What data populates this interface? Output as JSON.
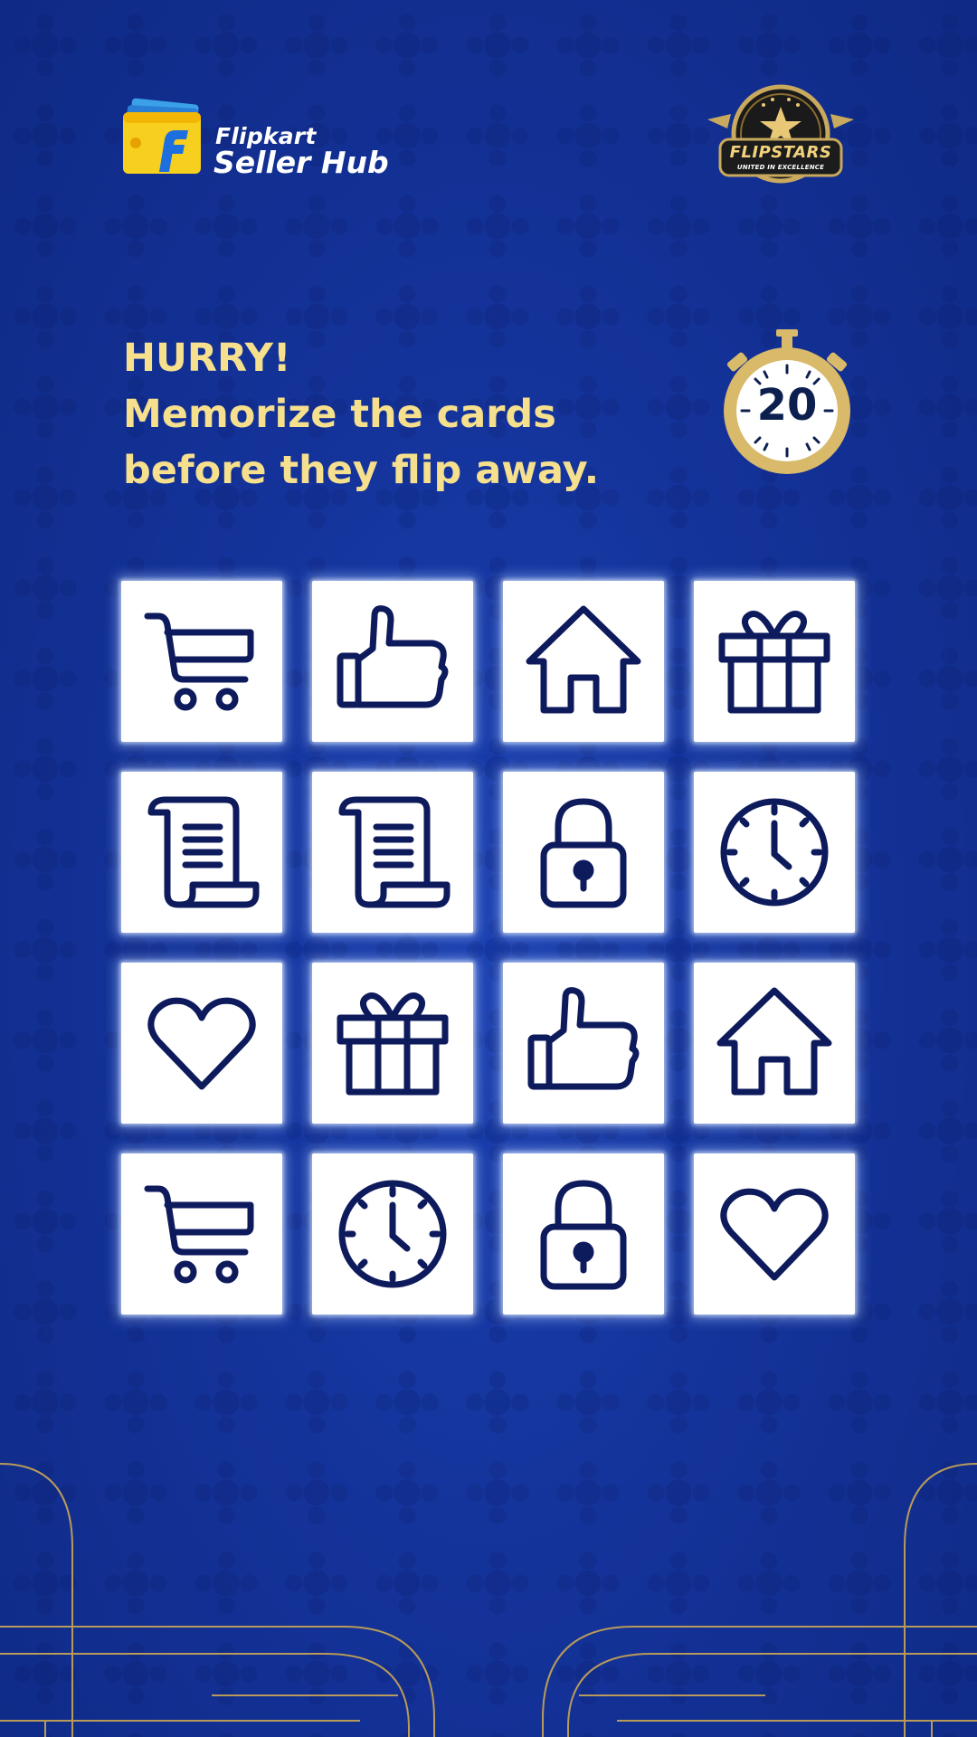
{
  "header": {
    "logo": {
      "brand": "Flipkart",
      "product": "Seller Hub",
      "icon": "wallet-f-icon"
    },
    "badge": {
      "title": "FLIPSTARS",
      "subtitle": "UNITED IN EXCELLENCE",
      "icon": "star-crest-icon"
    }
  },
  "instructions": {
    "line1": "HURRY!",
    "line2": "Memorize the cards",
    "line3": "before they flip away."
  },
  "timer": {
    "value": "20",
    "icon": "stopwatch-icon"
  },
  "colors": {
    "background": "#14339a",
    "accent_text": "#f6e08e",
    "gold": "#c9a95e",
    "icon_stroke": "#0d1a5c",
    "card": "#ffffff"
  },
  "grid": {
    "rows": 4,
    "columns": 4,
    "cards": [
      {
        "icon": "cart"
      },
      {
        "icon": "thumbs-up"
      },
      {
        "icon": "home"
      },
      {
        "icon": "gift"
      },
      {
        "icon": "scroll"
      },
      {
        "icon": "scroll"
      },
      {
        "icon": "lock"
      },
      {
        "icon": "clock"
      },
      {
        "icon": "heart"
      },
      {
        "icon": "gift"
      },
      {
        "icon": "thumbs-up"
      },
      {
        "icon": "home"
      },
      {
        "icon": "cart"
      },
      {
        "icon": "clock"
      },
      {
        "icon": "lock"
      },
      {
        "icon": "heart"
      }
    ]
  }
}
